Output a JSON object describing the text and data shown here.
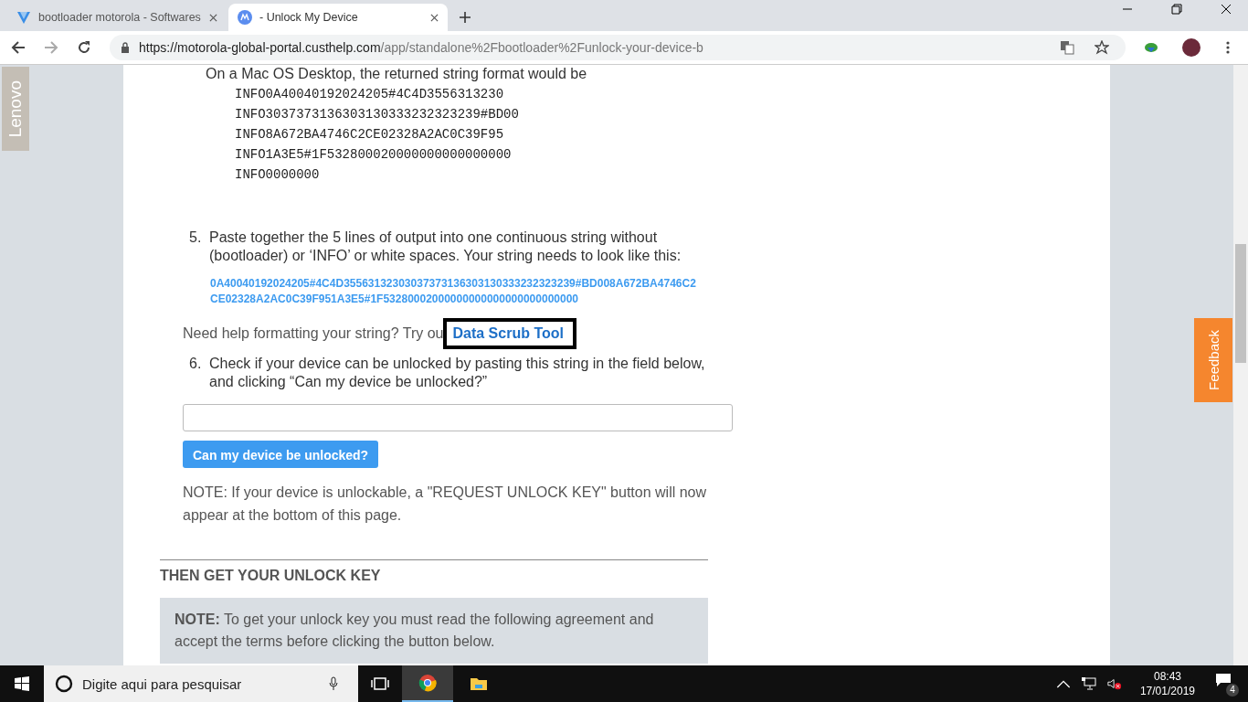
{
  "tabs": [
    {
      "title": "bootloader motorola - Softwares",
      "selected": false
    },
    {
      "title": "- Unlock My Device",
      "selected": true
    }
  ],
  "address": {
    "host": "https://motorola-global-portal.custhelp.com",
    "path": "/app/standalone%2Fbootloader%2Funlock-your-device-b"
  },
  "side_tab": "Lenovo",
  "feedback_tab": "Feedback",
  "page": {
    "intro": "On a Mac OS Desktop, the returned string format would be",
    "code_lines": [
      "INFO0A40040192024205#4C4D3556313230",
      "INFO3037373136303130333232323239#BD00",
      "INFO8A672BA4746C2CE02328A2AC0C39F95",
      "INFO1A3E5#1F532800020000000000000000",
      "INFO0000000"
    ],
    "step5": {
      "number": "5.",
      "text": "Paste together the 5 lines of output into one continuous string without (bootloader) or ‘INFO’ or white spaces. Your string needs to look like this:"
    },
    "sample_lines": [
      "0A40040192024205#4C4D35563132303037373136303130333232323239#BD008A672BA4746C2",
      "CE02328A2AC0C39F951A3E5#1F53280002000000000000000000000000"
    ],
    "help_text": "Need help formatting your string? Try ou",
    "help_link": "Data Scrub Tool",
    "step6": {
      "number": "6.",
      "text": "Check if your device can be unlocked by pasting this string in the field below, and clicking “Can my device be unlocked?”"
    },
    "button": "Can my device be unlocked?",
    "note": "NOTE: If your device is unlockable, a \"REQUEST UNLOCK KEY\" button will now appear at the bottom of this page.",
    "heading": "THEN GET YOUR UNLOCK KEY",
    "agreement_note": "**NOTE:** To get your unlock key you must read the following agreement and accept the terms before clicking the button below."
  },
  "taskbar": {
    "search_placeholder": "Digite aqui para pesquisar",
    "time": "08:43",
    "date": "17/01/2019",
    "notifications": "4"
  }
}
